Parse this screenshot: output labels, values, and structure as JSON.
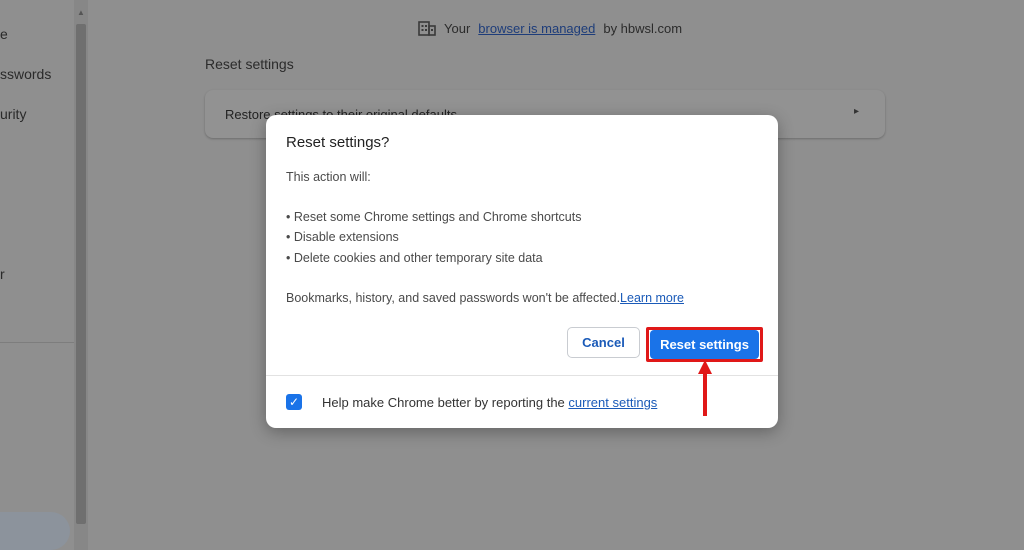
{
  "sidebar": {
    "items": [
      {
        "label": "e"
      },
      {
        "label": "sswords"
      },
      {
        "label": "urity"
      },
      {
        "label": "r"
      }
    ]
  },
  "banner": {
    "prefix": "Your",
    "link": "browser is managed",
    "suffix": "by hbwsl.com",
    "icon": "building-icon"
  },
  "section": {
    "title": "Reset settings",
    "row_label": "Restore settings to their original defaults",
    "row_arrow": "▸"
  },
  "dialog": {
    "title": "Reset settings?",
    "intro": "This action will:",
    "bullets": [
      "• Reset some Chrome settings and Chrome shortcuts",
      "• Disable extensions",
      "• Delete cookies and other temporary site data"
    ],
    "note": "Bookmarks, history, and saved passwords won't be affected.",
    "learn_more": "Learn more",
    "cancel_label": "Cancel",
    "reset_label": "Reset settings",
    "footer_text": "Help make Chrome better by reporting the",
    "footer_link": "current settings",
    "checkbox_checked": true
  },
  "colors": {
    "accent": "#1a73e8",
    "annotation": "#e01818"
  }
}
